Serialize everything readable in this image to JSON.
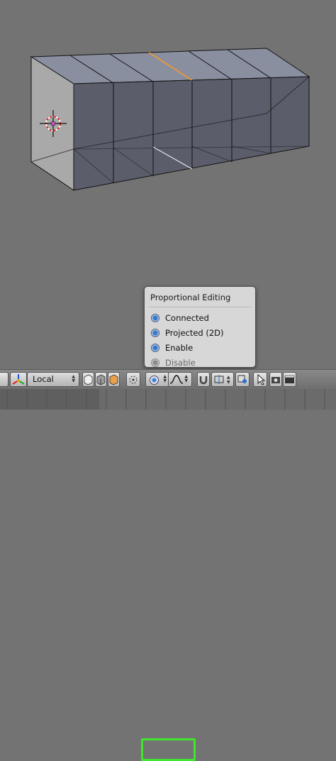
{
  "popup": {
    "title": "Proportional Editing",
    "items": [
      {
        "label": "Connected",
        "enabled": true
      },
      {
        "label": "Projected (2D)",
        "enabled": true
      },
      {
        "label": "Enable",
        "enabled": true
      },
      {
        "label": "Disable",
        "enabled": false
      }
    ]
  },
  "header": {
    "orientation_label": "Local"
  },
  "colors": {
    "viewport_bg": "#737373",
    "highlight": "#3ee62c",
    "selected_edge": "#ff9a1f",
    "radio_accent": "#3a78c9"
  }
}
